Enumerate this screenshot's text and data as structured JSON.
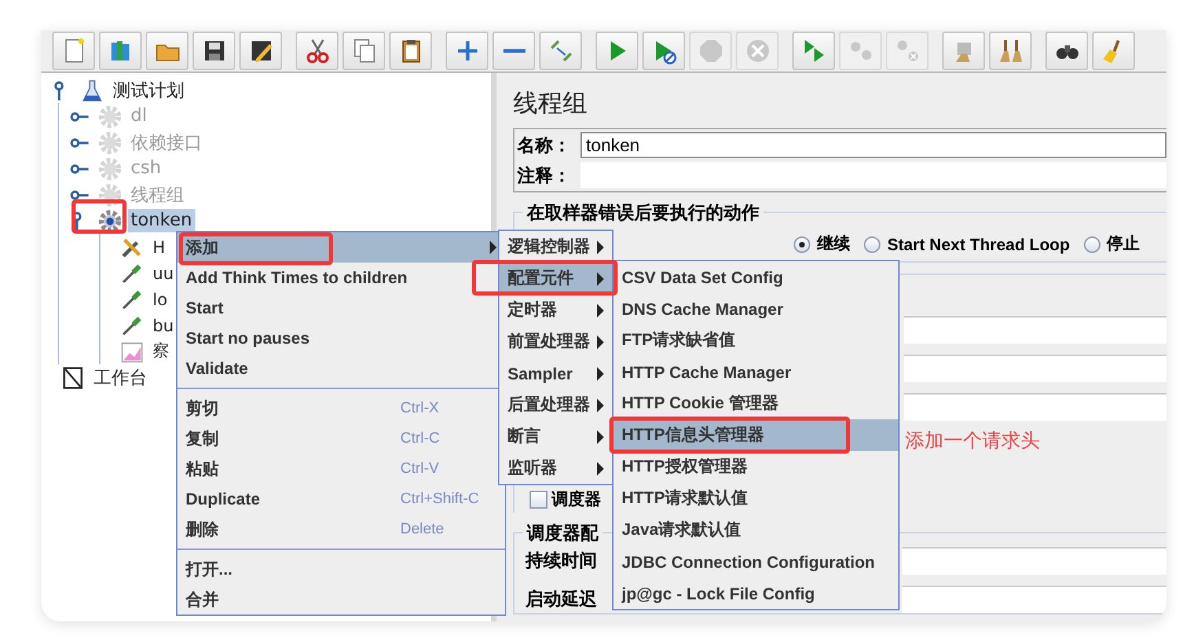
{
  "toolbar": {
    "groups": [
      {
        "buttons": [
          {
            "kind": "new",
            "disabled": false
          },
          {
            "kind": "templates",
            "disabled": false
          },
          {
            "kind": "open",
            "disabled": false
          },
          {
            "kind": "save",
            "disabled": false
          },
          {
            "kind": "save-as",
            "disabled": false
          }
        ]
      },
      {
        "buttons": [
          {
            "kind": "cut",
            "disabled": false
          },
          {
            "kind": "copy",
            "disabled": false
          },
          {
            "kind": "paste",
            "disabled": false
          }
        ]
      },
      {
        "buttons": [
          {
            "kind": "expand",
            "disabled": false
          },
          {
            "kind": "collapse",
            "disabled": false
          },
          {
            "kind": "toggle",
            "disabled": false
          }
        ]
      },
      {
        "buttons": [
          {
            "kind": "start",
            "disabled": false
          },
          {
            "kind": "start-no-pause",
            "disabled": false
          },
          {
            "kind": "stop",
            "disabled": true
          },
          {
            "kind": "shutdown",
            "disabled": true
          }
        ]
      },
      {
        "buttons": [
          {
            "kind": "remote-start",
            "disabled": false
          },
          {
            "kind": "remote-stop",
            "disabled": true
          },
          {
            "kind": "remote-exit",
            "disabled": true
          }
        ]
      },
      {
        "buttons": [
          {
            "kind": "clear",
            "disabled": false
          },
          {
            "kind": "clear-all",
            "disabled": false
          }
        ]
      },
      {
        "buttons": [
          {
            "kind": "search",
            "disabled": false
          },
          {
            "kind": "reset-search",
            "disabled": false
          }
        ]
      }
    ]
  },
  "tree": {
    "items": [
      {
        "label": "测试计划",
        "kind": "plan",
        "expanded": true,
        "selected": false,
        "children": [
          {
            "label": "dl",
            "kind": "thread-group",
            "disabled": true,
            "expanded": false,
            "selected": false
          },
          {
            "label": "依赖接口",
            "kind": "thread-group",
            "disabled": true,
            "expanded": false,
            "selected": false
          },
          {
            "label": "csh",
            "kind": "thread-group",
            "disabled": true,
            "expanded": false,
            "selected": false
          },
          {
            "label": "线程组",
            "kind": "thread-group",
            "disabled": true,
            "expanded": false,
            "selected": false
          },
          {
            "label": "tonken",
            "kind": "thread-group",
            "disabled": false,
            "expanded": true,
            "selected": true,
            "annotated": true,
            "children": [
              {
                "label": "H",
                "kind": "config",
                "selected": false
              },
              {
                "label": "uu",
                "kind": "sampler",
                "selected": false
              },
              {
                "label": "lo",
                "kind": "sampler",
                "selected": false
              },
              {
                "label": "bu",
                "kind": "sampler",
                "selected": false
              },
              {
                "label": "察",
                "kind": "listener",
                "selected": false
              }
            ]
          }
        ]
      },
      {
        "label": "工作台",
        "kind": "workbench",
        "selected": false
      }
    ]
  },
  "panel": {
    "title": "线程组",
    "name": {
      "label": "名称：",
      "value": "tonken"
    },
    "comment": {
      "label": "注释："
    },
    "error_action": {
      "title": "在取样器错误后要执行的动作",
      "options": [
        {
          "label": "继续",
          "selected": true
        },
        {
          "label": "Start Next Thread Loop",
          "selected": false
        },
        {
          "label": "停止",
          "selected": false
        }
      ]
    },
    "scheduler": {
      "label": "调度器",
      "checked": false
    },
    "scheduler_config": {
      "title": "调度器配",
      "fields": [
        {
          "label": "持续时间"
        },
        {
          "label": "启动延迟"
        }
      ]
    }
  },
  "context_menu": {
    "groups": [
      {
        "items": [
          {
            "label": "添加",
            "submenu": true,
            "selected": true,
            "annotated": true
          },
          {
            "label": "Add Think Times to children",
            "submenu": false,
            "selected": false
          },
          {
            "label": "Start",
            "submenu": false,
            "selected": false
          },
          {
            "label": "Start no pauses",
            "submenu": false,
            "selected": false
          },
          {
            "label": "Validate",
            "submenu": false,
            "selected": false
          }
        ]
      },
      {
        "items": [
          {
            "label": "剪切",
            "shortcut": "Ctrl-X",
            "submenu": false,
            "selected": false
          },
          {
            "label": "复制",
            "shortcut": "Ctrl-C",
            "submenu": false,
            "selected": false
          },
          {
            "label": "粘贴",
            "shortcut": "Ctrl-V",
            "submenu": false,
            "selected": false
          },
          {
            "label": "Duplicate",
            "shortcut": "Ctrl+Shift-C",
            "submenu": false,
            "selected": false
          },
          {
            "label": "删除",
            "shortcut": "Delete",
            "submenu": false,
            "selected": false
          }
        ]
      },
      {
        "items": [
          {
            "label": "打开...",
            "submenu": false,
            "selected": false
          },
          {
            "label": "合并",
            "submenu": false,
            "selected": false
          }
        ]
      }
    ]
  },
  "add_submenu": {
    "items": [
      {
        "label": "逻辑控制器",
        "submenu": true,
        "selected": false
      },
      {
        "label": "配置元件",
        "submenu": true,
        "selected": true,
        "annotated": true
      },
      {
        "label": "定时器",
        "submenu": true,
        "selected": false
      },
      {
        "label": "前置处理器",
        "submenu": true,
        "selected": false
      },
      {
        "label": "Sampler",
        "submenu": true,
        "selected": false
      },
      {
        "label": "后置处理器",
        "submenu": true,
        "selected": false
      },
      {
        "label": "断言",
        "submenu": true,
        "selected": false
      },
      {
        "label": "监听器",
        "submenu": true,
        "selected": false
      }
    ]
  },
  "config_submenu": {
    "items": [
      {
        "label": "CSV Data Set Config",
        "selected": false
      },
      {
        "label": "DNS Cache Manager",
        "selected": false
      },
      {
        "label": "FTP请求缺省值",
        "selected": false
      },
      {
        "label": "HTTP Cache Manager",
        "selected": false
      },
      {
        "label": "HTTP Cookie 管理器",
        "selected": false
      },
      {
        "label": "HTTP信息头管理器",
        "selected": true,
        "annotated": true
      },
      {
        "label": "HTTP授权管理器",
        "selected": false
      },
      {
        "label": "HTTP请求默认值",
        "selected": false
      },
      {
        "label": "Java请求默认值",
        "selected": false
      },
      {
        "label": "JDBC Connection Configuration",
        "selected": false
      },
      {
        "label": "jp@gc - Lock File Config",
        "selected": false
      }
    ]
  },
  "annotation_note": "添加一个请求头"
}
